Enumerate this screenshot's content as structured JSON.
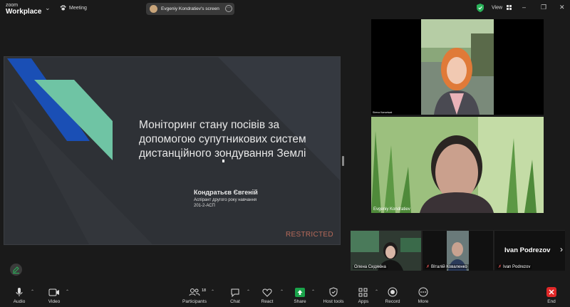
{
  "topbar": {
    "logo_small": "zoom",
    "logo_big": "Workplace",
    "meeting_label": "Meeting",
    "screen_label": "Evgeniy Kondratiev's screen",
    "view_label": "View"
  },
  "slide": {
    "title": "Моніторинг стану посівів за допомогою супутникових систем дистанційного зондування Землі",
    "author": "Кондратьєв Євгеній",
    "role_line1": "Аспірант другого року навчання",
    "role_line2": "201-2-АСП",
    "restricted": "RESTRICTED",
    "colors": {
      "blue": "#1a4fb5",
      "green": "#6fc4a4",
      "bg": "#2e3136"
    }
  },
  "videos": [
    {
      "name": "Sirena Kanseiwat"
    },
    {
      "name": "Evgeniy Kondratiev"
    }
  ],
  "thumbnails": [
    {
      "name": "Олена Сидякіна",
      "muted": false
    },
    {
      "name": "Віталій Коваленко",
      "muted": true
    },
    {
      "name": "Ivan Podrezov",
      "muted": true
    }
  ],
  "speaker_big_name": "Ivan Podrezov",
  "toolbar": {
    "audio": "Audio",
    "video": "Video",
    "participants": "Participants",
    "participants_count": "18",
    "chat": "Chat",
    "react": "React",
    "share": "Share",
    "host_tools": "Host tools",
    "apps": "Apps",
    "record": "Record",
    "more": "More",
    "end": "End",
    "colors": {
      "share": "#1aa34a",
      "end": "#e02828"
    }
  }
}
